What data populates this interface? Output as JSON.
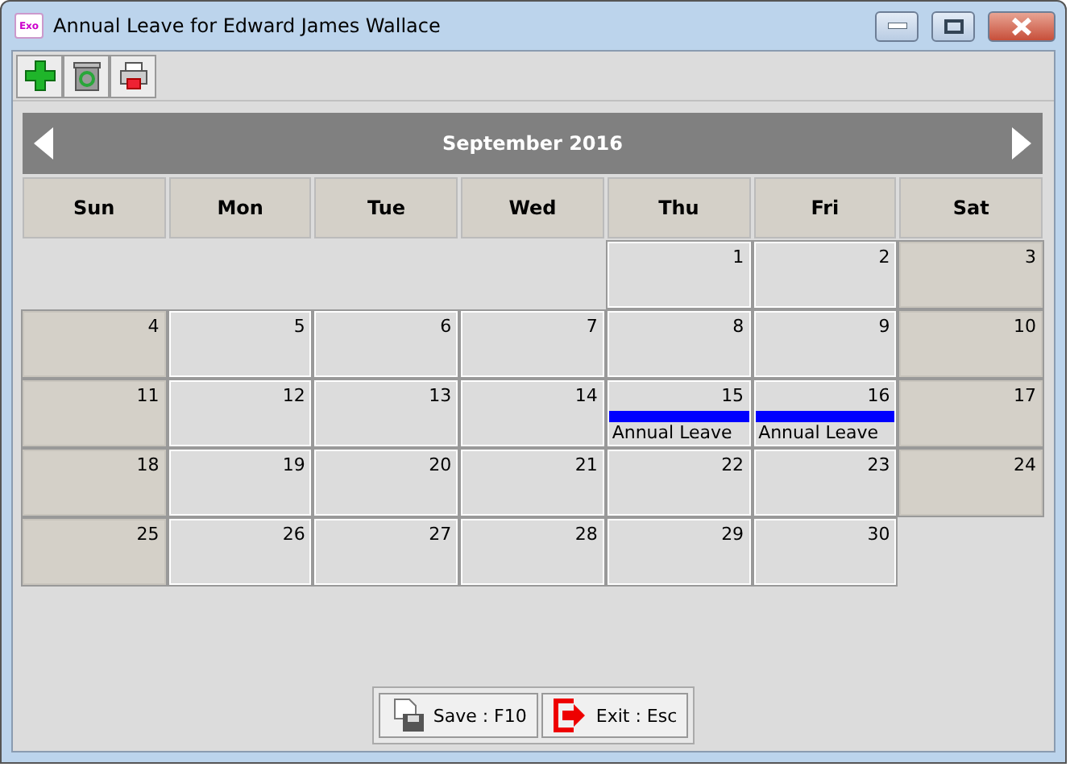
{
  "window": {
    "app_badge": "Exo",
    "title": "Annual Leave for Edward James Wallace"
  },
  "toolbar": [
    {
      "kind": "add"
    },
    {
      "kind": "refresh"
    },
    {
      "kind": "print"
    }
  ],
  "calendar": {
    "month": "September 2016",
    "weekdays": [
      "Sun",
      "Mon",
      "Tue",
      "Wed",
      "Thu",
      "Fri",
      "Sat"
    ],
    "weeks": [
      [
        {
          "kind": "blank"
        },
        {
          "kind": "blank"
        },
        {
          "kind": "blank"
        },
        {
          "kind": "blank"
        },
        {
          "kind": "day",
          "day": "1",
          "weekend": false
        },
        {
          "kind": "day",
          "day": "2",
          "weekend": false
        },
        {
          "kind": "day",
          "day": "3",
          "weekend": true
        }
      ],
      [
        {
          "kind": "day",
          "day": "4",
          "weekend": true
        },
        {
          "kind": "day",
          "day": "5",
          "weekend": false
        },
        {
          "kind": "day",
          "day": "6",
          "weekend": false
        },
        {
          "kind": "day",
          "day": "7",
          "weekend": false
        },
        {
          "kind": "day",
          "day": "8",
          "weekend": false
        },
        {
          "kind": "day",
          "day": "9",
          "weekend": false
        },
        {
          "kind": "day",
          "day": "10",
          "weekend": true
        }
      ],
      [
        {
          "kind": "day",
          "day": "11",
          "weekend": true
        },
        {
          "kind": "day",
          "day": "12",
          "weekend": false
        },
        {
          "kind": "day",
          "day": "13",
          "weekend": false
        },
        {
          "kind": "day",
          "day": "14",
          "weekend": false
        },
        {
          "kind": "day",
          "day": "15",
          "weekend": false,
          "events": [
            {
              "label": "Annual Leave",
              "color": "#0000ff"
            }
          ]
        },
        {
          "kind": "day",
          "day": "16",
          "weekend": false,
          "events": [
            {
              "label": "Annual Leave",
              "color": "#0000ff"
            }
          ]
        },
        {
          "kind": "day",
          "day": "17",
          "weekend": true
        }
      ],
      [
        {
          "kind": "day",
          "day": "18",
          "weekend": true
        },
        {
          "kind": "day",
          "day": "19",
          "weekend": false
        },
        {
          "kind": "day",
          "day": "20",
          "weekend": false
        },
        {
          "kind": "day",
          "day": "21",
          "weekend": false
        },
        {
          "kind": "day",
          "day": "22",
          "weekend": false
        },
        {
          "kind": "day",
          "day": "23",
          "weekend": false
        },
        {
          "kind": "day",
          "day": "24",
          "weekend": true
        }
      ],
      [
        {
          "kind": "day",
          "day": "25",
          "weekend": true
        },
        {
          "kind": "day",
          "day": "26",
          "weekend": false
        },
        {
          "kind": "day",
          "day": "27",
          "weekend": false
        },
        {
          "kind": "day",
          "day": "28",
          "weekend": false
        },
        {
          "kind": "day",
          "day": "29",
          "weekend": false
        },
        {
          "kind": "day",
          "day": "30",
          "weekend": false
        },
        {
          "kind": "blank"
        }
      ]
    ]
  },
  "buttons": [
    {
      "kind": "save",
      "label": "Save : F10"
    },
    {
      "kind": "exit",
      "label": "Exit : Esc"
    }
  ]
}
